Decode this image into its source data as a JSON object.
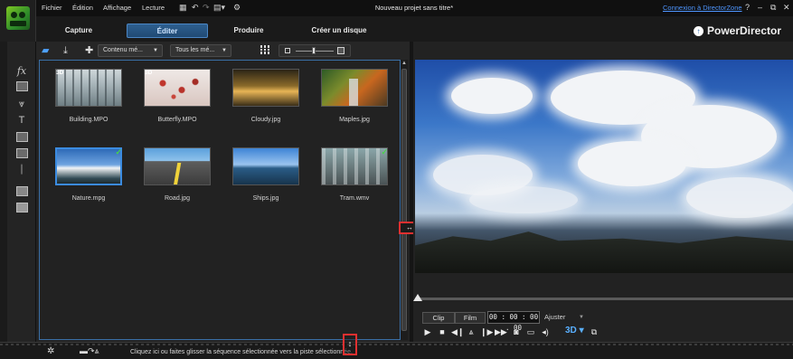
{
  "menu": {
    "items": [
      "Fichier",
      "Édition",
      "Affichage",
      "Lecture"
    ],
    "window_title": "Nouveau projet sans titre*",
    "login_link": "Connexion à DirectorZone",
    "help": "?",
    "minimize": "–",
    "restore": "⧉",
    "close": "✕"
  },
  "modes": {
    "tabs": [
      "Capture",
      "Éditer",
      "Produire",
      "Créer un disque"
    ],
    "active": "Éditer",
    "brand": "PowerDirector"
  },
  "library": {
    "dropdown_content": "Contenu mé...",
    "dropdown_all": "Tous les mé...",
    "items": [
      {
        "label": "Building.MPO",
        "badge": "3D",
        "art": "building"
      },
      {
        "label": "Butterfly.MPO",
        "badge": "3D",
        "art": "butterfly"
      },
      {
        "label": "Cloudy.jpg",
        "badge": "",
        "art": "cloudy"
      },
      {
        "label": "Maples.jpg",
        "badge": "",
        "art": "maples"
      },
      {
        "label": "Nature.mpg",
        "badge": "",
        "art": "nature",
        "selected": true,
        "checked": true
      },
      {
        "label": "Road.jpg",
        "badge": "",
        "art": "road"
      },
      {
        "label": "Ships.jpg",
        "badge": "",
        "art": "ships"
      },
      {
        "label": "Tram.wmv",
        "badge": "",
        "art": "tram",
        "checked": true
      }
    ]
  },
  "preview": {
    "clip_label": "Clip",
    "film_label": "Film",
    "timecode": "00 : 00 : 00 . 00",
    "fit_label": "Ajuster",
    "button_3d": "3D"
  },
  "timeline": {
    "hint": "Cliquez ici ou faites glisser la séquence sélectionnée vers la piste sélectionnée."
  },
  "icons": {
    "rail": [
      "media-room-icon",
      "fx-icon",
      "pip-icon",
      "particle-icon",
      "title-icon",
      "transition-icon",
      "audio-mixing-icon",
      "voiceover-icon",
      "chapter-icon",
      "subtitle-icon"
    ]
  },
  "colors": {
    "accent": "#3b8be0",
    "link": "#4e96ff",
    "highlight": "#e03030"
  }
}
